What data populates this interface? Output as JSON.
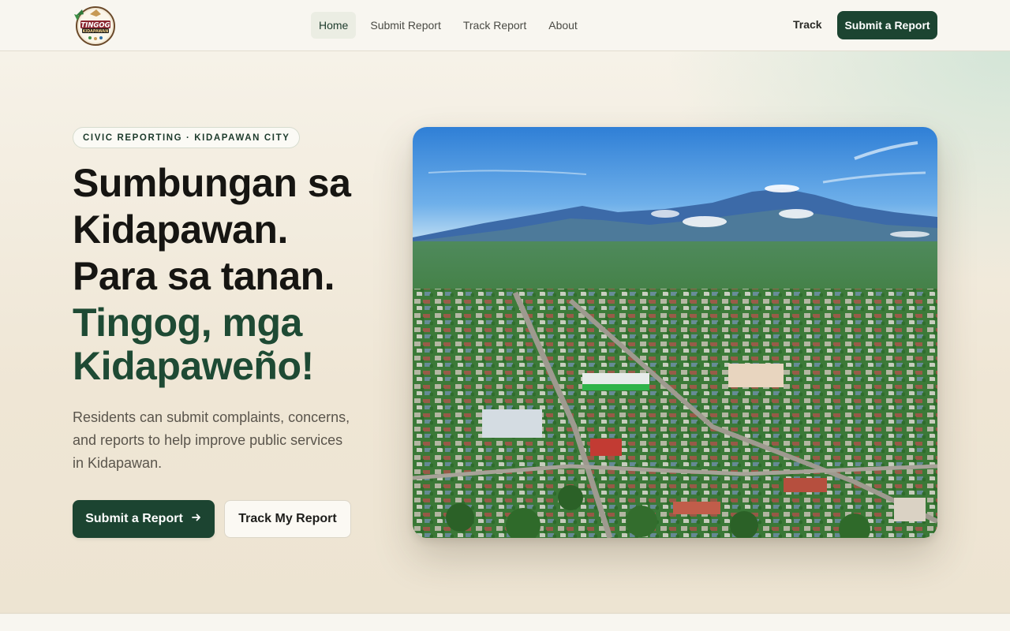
{
  "header": {
    "logo_text_top": "TINGOG",
    "logo_text_bottom": "KIDAPAWAN",
    "nav": [
      {
        "label": "Home",
        "active": true
      },
      {
        "label": "Submit Report",
        "active": false
      },
      {
        "label": "Track Report",
        "active": false
      },
      {
        "label": "About",
        "active": false
      }
    ],
    "track_label": "Track",
    "cta_label": "Submit a Report"
  },
  "hero": {
    "badge": "CIVIC REPORTING · KIDAPAWAN CITY",
    "headline_lines": [
      "Sumbungan sa",
      "Kidapawan.",
      "Para sa tanan."
    ],
    "headline_green_lines": [
      "Tingog, mga",
      "Kidapaweño!"
    ],
    "description": "Residents can submit complaints, concerns, and reports to help improve public services in Kidapawan.",
    "primary_button": "Submit a Report",
    "primary_button_icon": "arrow-right-icon",
    "secondary_button": "Track My Report",
    "image_alt": "aerial-city-mountain-photo"
  },
  "colors": {
    "brand_green": "#1c4431",
    "headline_green": "#1e4a34",
    "background": "#f6f3ea"
  }
}
